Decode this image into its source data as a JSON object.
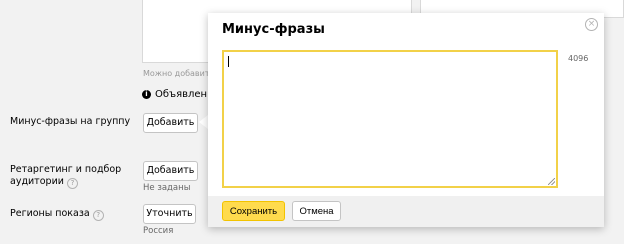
{
  "background": {
    "hint": "Можно добавить ещ",
    "notice": "Объявление",
    "rows": [
      {
        "label": "Минус-фразы на группу",
        "button": "Добавить",
        "status": ""
      },
      {
        "label_line1": "Ретаргетинг и подбор",
        "label_line2": "аудитории",
        "button": "Добавить",
        "status": "Не заданы"
      },
      {
        "label": "Регионы показа",
        "button": "Уточнить",
        "status": "Россия"
      }
    ]
  },
  "modal": {
    "title": "Минус-фразы",
    "input_value": "",
    "char_limit": "4096",
    "save_label": "Сохранить",
    "cancel_label": "Отмена",
    "close_icon": "close-icon"
  },
  "colors": {
    "accent": "#ffdb4d",
    "focus_border": "#f2d148"
  }
}
